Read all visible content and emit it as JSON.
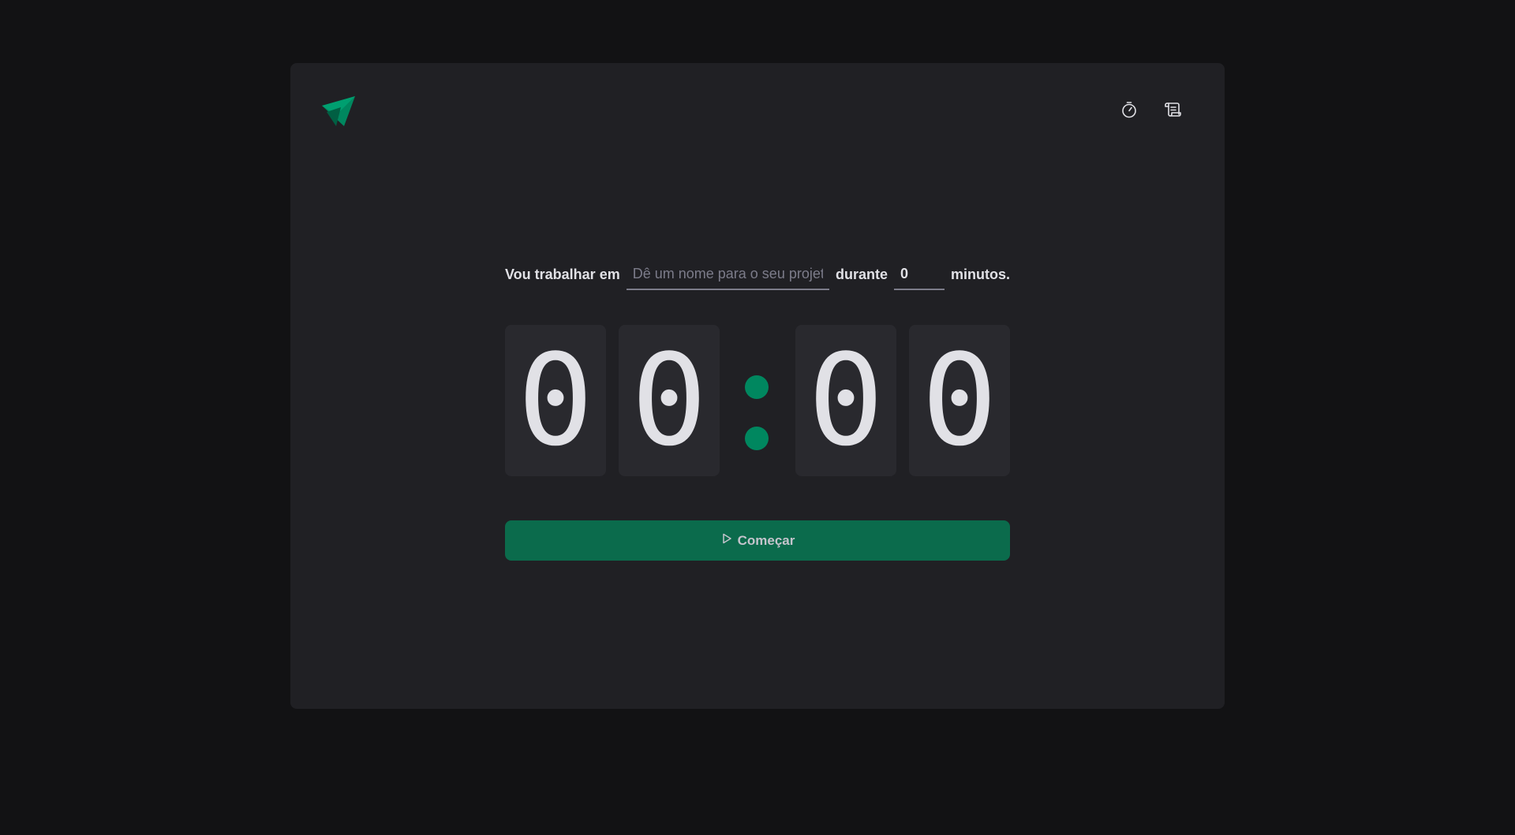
{
  "header": {
    "logo_icon": "ignite-timer-logo-icon",
    "nav": [
      {
        "icon": "timer-icon"
      },
      {
        "icon": "scroll-icon"
      }
    ]
  },
  "form": {
    "task_label": "Vou trabalhar em",
    "task_placeholder": "Dê um nome para o seu projeto",
    "task_value": "",
    "duration_label": "durante",
    "minutes_value": "0",
    "minutes_suffix": "minutos."
  },
  "countdown": {
    "minutes_tens": "0",
    "minutes_ones": "0",
    "seconds_tens": "0",
    "seconds_ones": "0"
  },
  "start_button": {
    "icon": "play-icon",
    "label": "Começar"
  },
  "colors": {
    "page_bg": "#121214",
    "card_bg": "#202024",
    "digit_bg": "#29292e",
    "accent": "#00875f",
    "button_bg": "#0b6b4c",
    "text": "#e1e1e6",
    "placeholder": "#7c7c8a"
  }
}
